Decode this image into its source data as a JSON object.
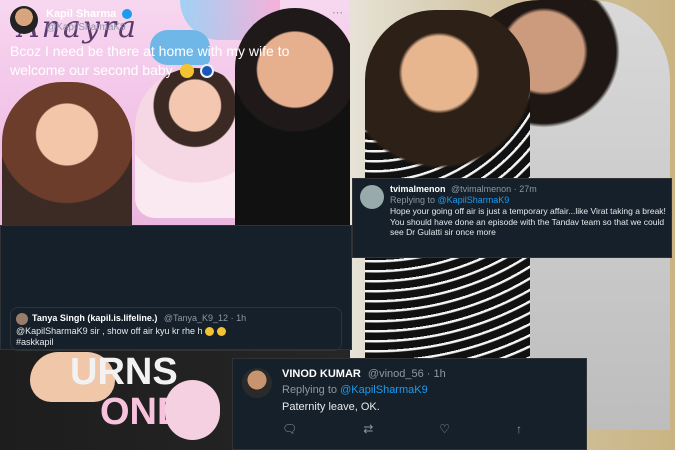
{
  "left_photo": {
    "backdrop_text": "Anayra",
    "cake_text": ""
  },
  "main_tweet": {
    "name": "Kapil Sharma",
    "handle": "@KapilSharmaK9",
    "text": "Bcoz I need be there at home with my wife to welcome our second baby",
    "emoji": [
      "smiling-face-icon",
      "nazar-amulet-icon"
    ],
    "more_icon": "more-icon",
    "quote": {
      "name": "Tanya Singh (kapil.is.lifeline.)",
      "handle": "@Tanya_K9_12",
      "time": "1h",
      "text": "@KapilSharmaK9 sir , show off air kyu kr rhe h",
      "hashtag": "#askkapil"
    }
  },
  "reply_tvimal": {
    "name": "tvimalmenon",
    "handle": "@tvimalmenon",
    "time": "27m",
    "replying_to_prefix": "Replying to",
    "replying_to": "@KapilSharmaK9",
    "text": "Hope your going off air is just a temporary affair...like Virat taking a break! You should have done an episode with the Tandav team so that we could see Dr Gulatti sir once more"
  },
  "reply_vinod": {
    "name": "VINOD KUMAR",
    "handle": "@vinod_56",
    "time": "1h",
    "replying_to_prefix": "Replying to",
    "replying_to": "@KapilSharmaK9",
    "text": "Paternity leave, OK.",
    "actions": [
      "reply-icon",
      "retweet-icon",
      "like-icon",
      "share-icon"
    ]
  },
  "bottom_photo": {
    "shirt_text_1": "URNS",
    "shirt_text_2": "ONE"
  }
}
